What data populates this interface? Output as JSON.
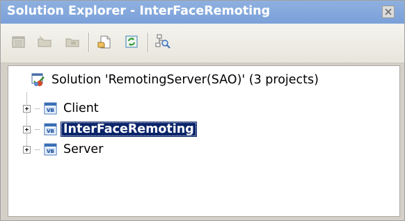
{
  "window": {
    "title": "Solution Explorer - InterFaceRemoting"
  },
  "toolbar": {
    "buttons": [
      {
        "icon": "properties-icon"
      },
      {
        "icon": "new-folder-icon"
      },
      {
        "icon": "open-folder-icon"
      },
      {
        "icon": "show-all-files-icon"
      },
      {
        "icon": "refresh-icon"
      },
      {
        "icon": "class-view-icon"
      }
    ]
  },
  "tree": {
    "solution": {
      "label": "Solution 'RemotingServer(SAO)' (3 projects)",
      "icon": "solution-icon"
    },
    "projects": [
      {
        "label": "Client",
        "icon": "vb-project-icon",
        "selected": false
      },
      {
        "label": "InterFaceRemoting",
        "icon": "vb-project-icon",
        "selected": true
      },
      {
        "label": "Server",
        "icon": "vb-project-icon",
        "selected": false
      }
    ]
  },
  "colors": {
    "titlebar": "#7aa0d8",
    "selection": "#0a246a",
    "toolbar": "#ece9d8"
  }
}
